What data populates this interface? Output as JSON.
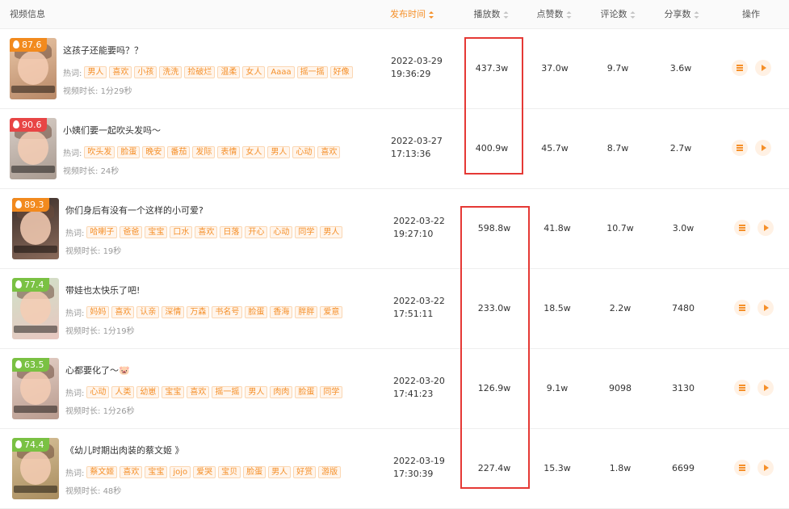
{
  "header": {
    "video_info": "视频信息",
    "publish_time": "发布时间",
    "plays": "播放数",
    "likes": "点赞数",
    "comments": "评论数",
    "shares": "分享数",
    "actions": "操作"
  },
  "labels": {
    "hotwords": "热词:",
    "duration_prefix": "视频时长:"
  },
  "colors": {
    "accent": "#f5902a",
    "score_orange": "#f28a1e",
    "score_red": "#e84545",
    "score_green": "#7ac143",
    "highlight_box": "#e53935"
  },
  "icons": {
    "score": "flame-icon",
    "detail": "list-icon",
    "play": "play-icon"
  },
  "rows": [
    {
      "score": "87.6",
      "score_color": "orange",
      "title": "这孩子还能要吗？？",
      "tags": [
        "男人",
        "喜欢",
        "小孩",
        "洗洗",
        "捡破烂",
        "温柔",
        "女人",
        "Aaaa",
        "摇一摇",
        "好像"
      ],
      "duration": "1分29秒",
      "date": "2022-03-29",
      "time": "19:36:29",
      "plays": "437.3w",
      "likes": "37.0w",
      "comments": "9.7w",
      "shares": "3.6w"
    },
    {
      "score": "90.6",
      "score_color": "red",
      "title": "小姨们要一起吹头发吗～",
      "tags": [
        "吹头发",
        "脸蛋",
        "晚安",
        "番茄",
        "发际",
        "表情",
        "女人",
        "男人",
        "心动",
        "喜欢"
      ],
      "duration": "24秒",
      "date": "2022-03-27",
      "time": "17:13:36",
      "plays": "400.9w",
      "likes": "45.7w",
      "comments": "8.7w",
      "shares": "2.7w"
    },
    {
      "score": "89.3",
      "score_color": "orange",
      "title": "你们身后有没有一个这样的小可爱?",
      "tags": [
        "哈喇子",
        "爸爸",
        "宝宝",
        "口水",
        "喜欢",
        "日落",
        "开心",
        "心动",
        "同学",
        "男人"
      ],
      "duration": "19秒",
      "date": "2022-03-22",
      "time": "19:27:10",
      "plays": "598.8w",
      "likes": "41.8w",
      "comments": "10.7w",
      "shares": "3.0w"
    },
    {
      "score": "77.4",
      "score_color": "green",
      "title": "带娃也太快乐了吧!",
      "tags": [
        "妈妈",
        "喜欢",
        "认亲",
        "深情",
        "万森",
        "书名号",
        "脸蛋",
        "香海",
        "胖胖",
        "爱意"
      ],
      "duration": "1分19秒",
      "date": "2022-03-22",
      "time": "17:51:11",
      "plays": "233.0w",
      "likes": "18.5w",
      "comments": "2.2w",
      "shares": "7480"
    },
    {
      "score": "63.5",
      "score_color": "green",
      "title": "心都要化了～🐷",
      "tags": [
        "心动",
        "人类",
        "幼崽",
        "宝宝",
        "喜欢",
        "摇一摇",
        "男人",
        "肉肉",
        "脸蛋",
        "同学"
      ],
      "duration": "1分26秒",
      "date": "2022-03-20",
      "time": "17:41:23",
      "plays": "126.9w",
      "likes": "9.1w",
      "comments": "9098",
      "shares": "3130"
    },
    {
      "score": "74.4",
      "score_color": "green",
      "title": "《幼儿时期出肉装的蔡文姬 》",
      "tags": [
        "蔡文姬",
        "喜欢",
        "宝宝",
        "jojo",
        "爱哭",
        "宝贝",
        "脸蛋",
        "男人",
        "好赏",
        "游版"
      ],
      "duration": "48秒",
      "date": "2022-03-19",
      "time": "17:30:39",
      "plays": "227.4w",
      "likes": "15.3w",
      "comments": "1.8w",
      "shares": "6699"
    }
  ]
}
